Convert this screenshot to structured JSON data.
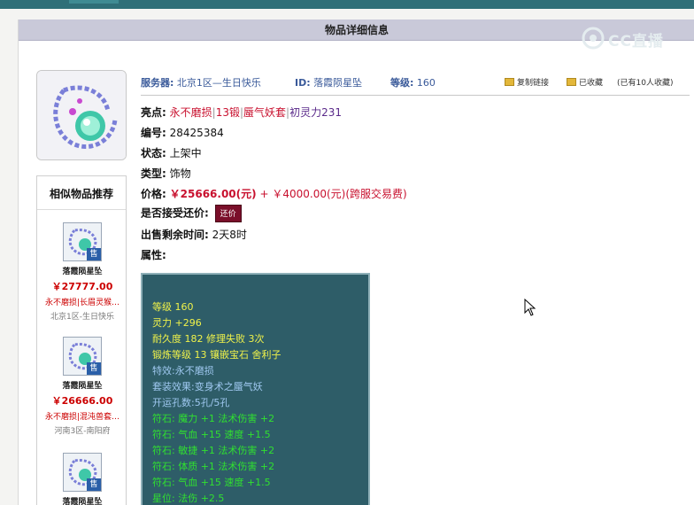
{
  "title": "物品详细信息",
  "watermark": "CC直播",
  "info": {
    "server_label": "服务器:",
    "server_value": "北京1区—生日快乐",
    "id_label": "ID:",
    "id_value": "落霞陨星坠",
    "level_label": "等级:",
    "level_value": "160",
    "copy_link": "复制链接",
    "favorite": "已收藏",
    "fav_count": "(已有10人收藏)"
  },
  "detail": {
    "highlight_label": "亮点:",
    "highlights": [
      "永不磨损",
      "13锻",
      "蜃气妖套",
      "初灵力231"
    ],
    "serial_label": "编号:",
    "serial_value": "28425384",
    "status_label": "状态:",
    "status_value": "上架中",
    "type_label": "类型:",
    "type_value": "饰物",
    "price_label": "价格:",
    "price_value": "￥25666.00(元)",
    "price_plus": "+",
    "fee_value": "￥4000.00(元)(跨服交易费)",
    "counter_label": "是否接受还价:",
    "counter_button": "还价",
    "remaining_label": "出售剩余时间:",
    "remaining_value": "2天8时",
    "attr_label": "属性:"
  },
  "attributes": {
    "lines_yellow": [
      "等级 160",
      "灵力 +296",
      "耐久度 182 修理失败 3次",
      "锻炼等级 13 镶嵌宝石 舍利子"
    ],
    "lines_blue": [
      "特效:永不磨损",
      "套装效果:变身术之蜃气妖",
      "开运孔数:5孔/5孔"
    ],
    "lines_green": [
      "符石: 魔力 +1 法术伤害 +2",
      "符石: 气血 +15 速度 +1.5",
      "符石: 敏捷 +1 法术伤害 +2",
      "符石: 体质 +1 法术伤害 +2",
      "符石: 气血 +15 速度 +1.5",
      "星位: 法伤 +2.5"
    ]
  },
  "similar": {
    "title": "相似物品推荐",
    "items": [
      {
        "name": "落霞陨星坠",
        "price": "￥27777.00",
        "tags": "永不磨损|长眉灵猴…",
        "server": "北京1区-生日快乐",
        "sold": "售"
      },
      {
        "name": "落霞陨星坠",
        "price": "￥26666.00",
        "tags": "永不磨损|混沌兽套…",
        "server": "河南3区-南阳府",
        "sold": "售"
      },
      {
        "name": "落霞陨星坠",
        "price": "",
        "tags": "",
        "server": "",
        "sold": "售"
      }
    ]
  },
  "colors": {
    "accent": "#2f6f78",
    "price_red": "#c8102e",
    "attr_bg": "#2e5d68"
  }
}
